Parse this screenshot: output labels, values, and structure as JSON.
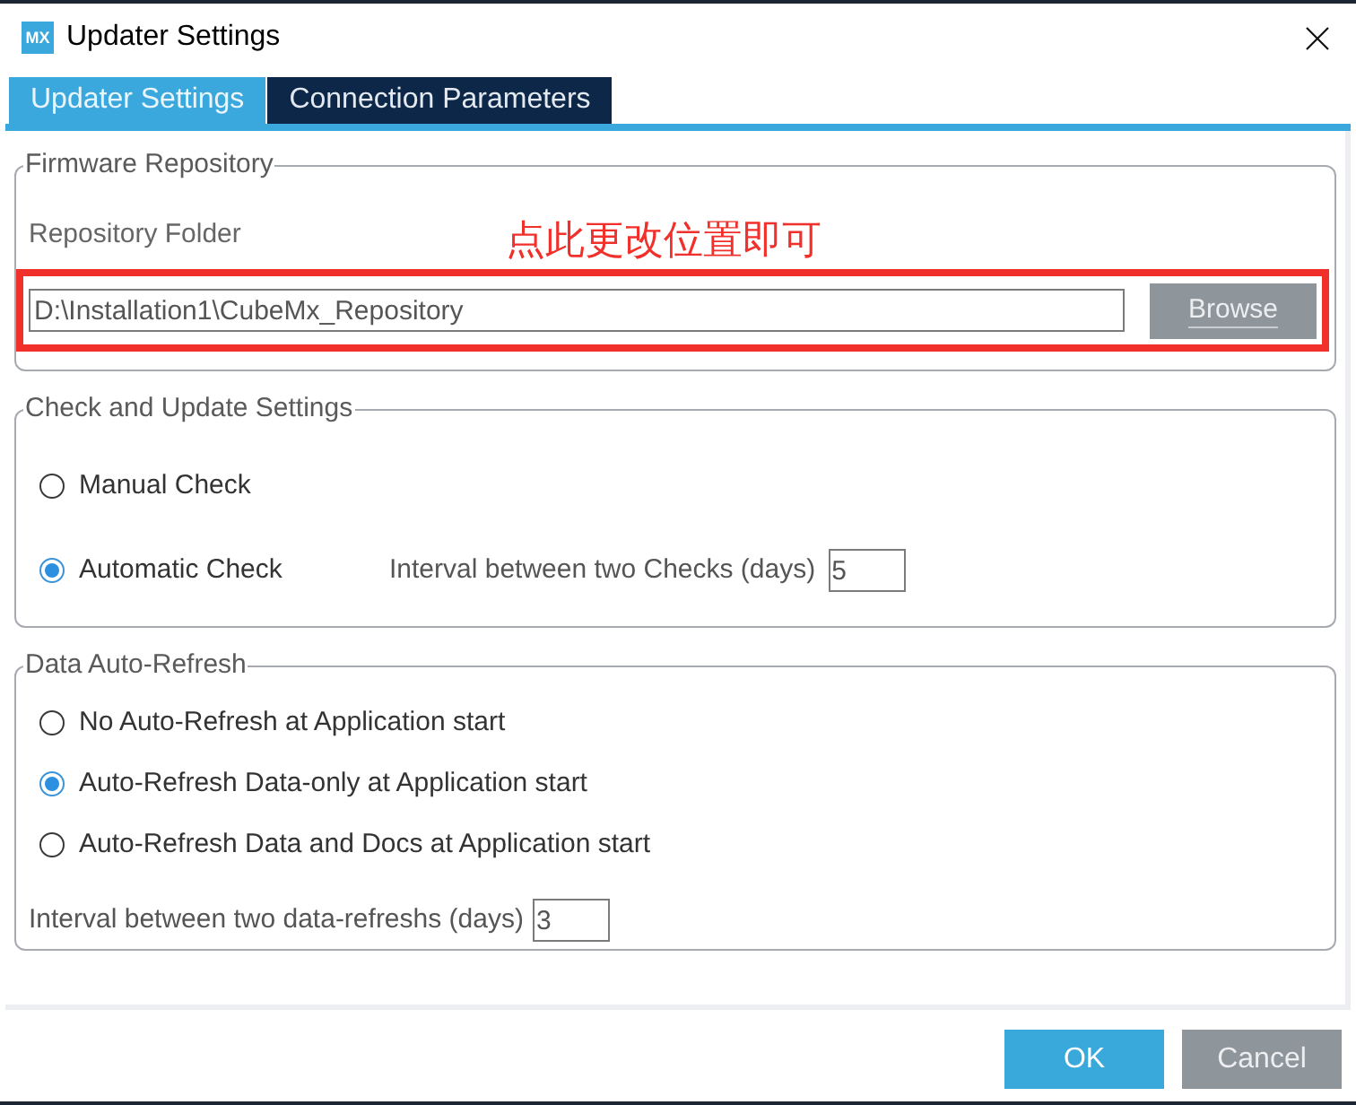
{
  "window": {
    "icon_text": "MX",
    "title": "Updater Settings"
  },
  "tabs": [
    {
      "label": "Updater Settings",
      "selected": true
    },
    {
      "label": "Connection Parameters",
      "selected": false
    }
  ],
  "firmware_repository": {
    "legend": "Firmware Repository",
    "folder_label": "Repository Folder",
    "annotation": "点此更改位置即可",
    "highlighted": true,
    "folder_field": {
      "value": "D:\\Installation1\\CubeMx_Repository"
    },
    "browse_button": "Browse"
  },
  "check_and_update": {
    "legend": "Check and Update Settings",
    "options": [
      {
        "label": "Manual Check",
        "selected": false
      },
      {
        "label": "Automatic Check",
        "selected": true
      }
    ],
    "interval_label": "Interval between two Checks (days)",
    "interval_field": {
      "value": "5"
    }
  },
  "data_auto_refresh": {
    "legend": "Data Auto-Refresh",
    "options": [
      {
        "label": "No Auto-Refresh at Application start",
        "selected": false
      },
      {
        "label": "Auto-Refresh Data-only at Application start",
        "selected": true
      },
      {
        "label": "Auto-Refresh Data and Docs at Application start",
        "selected": false
      }
    ],
    "interval_label": "Interval between two data-refreshs (days)",
    "interval_field": {
      "value": "3"
    }
  },
  "buttons": [
    {
      "label": "OK",
      "kind": "primary"
    },
    {
      "label": "Cancel",
      "kind": "secondary"
    }
  ]
}
